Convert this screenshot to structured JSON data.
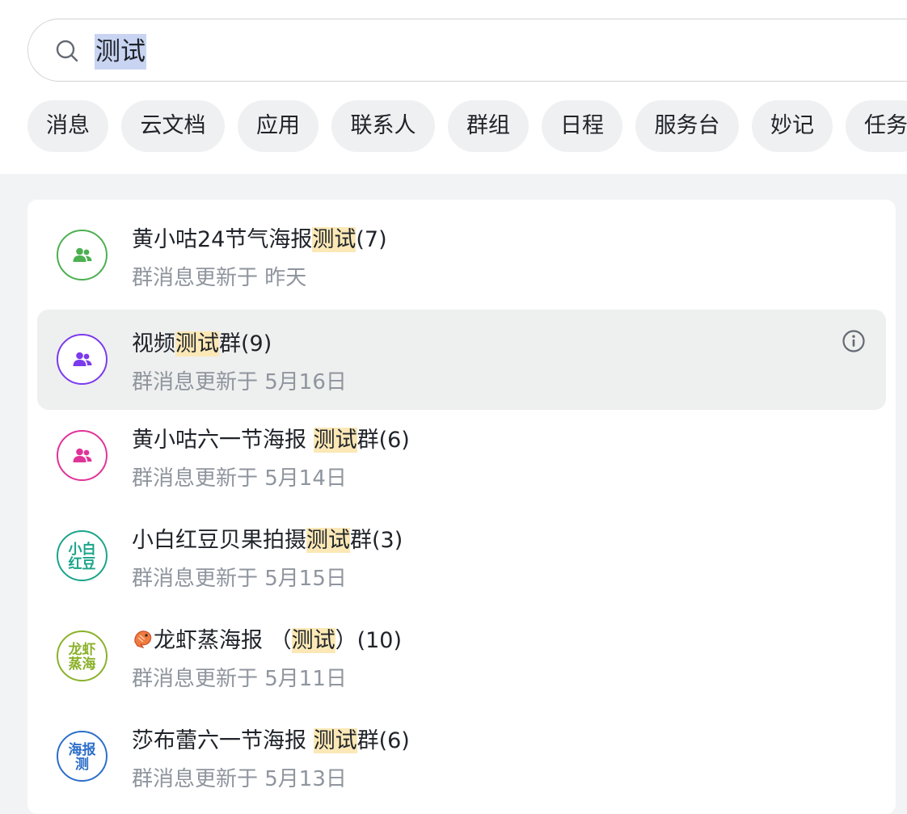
{
  "search": {
    "query": "测试"
  },
  "filters": [
    "消息",
    "云文档",
    "应用",
    "联系人",
    "群组",
    "日程",
    "服务台",
    "妙记",
    "任务"
  ],
  "results": [
    {
      "prefix": "黄小咕24节气海报",
      "highlight": "测试",
      "suffix": "(7)",
      "subtitle": "群消息更新于 昨天"
    },
    {
      "prefix": "视频",
      "highlight": "测试",
      "suffix": "群(9)",
      "subtitle": "群消息更新于 5月16日"
    },
    {
      "prefix": "黄小咕六一节海报 ",
      "highlight": "测试",
      "suffix": "群(6)",
      "subtitle": "群消息更新于 5月14日"
    },
    {
      "prefix": "小白红豆贝果拍摄",
      "highlight": "测试",
      "suffix": "群(3)",
      "subtitle": "群消息更新于 5月15日",
      "avatar_text": "小白\n红豆"
    },
    {
      "prefix": "龙虾蒸海报 （",
      "highlight": "测试",
      "suffix": "）(10)",
      "subtitle": "群消息更新于 5月11日",
      "avatar_text": "龙虾\n蒸海"
    },
    {
      "prefix": "莎布蕾六一节海报 ",
      "highlight": "测试",
      "suffix": "群(6)",
      "subtitle": "群消息更新于 5月13日",
      "avatar_text": "海报\n测"
    }
  ],
  "colors": {
    "green": "#4caf50",
    "purple": "#7c3aed",
    "pink": "#e03399",
    "teal": "#1aa489",
    "olive": "#8bb12a",
    "blue": "#2d6ec9",
    "highlight": "#fbe8b6"
  }
}
